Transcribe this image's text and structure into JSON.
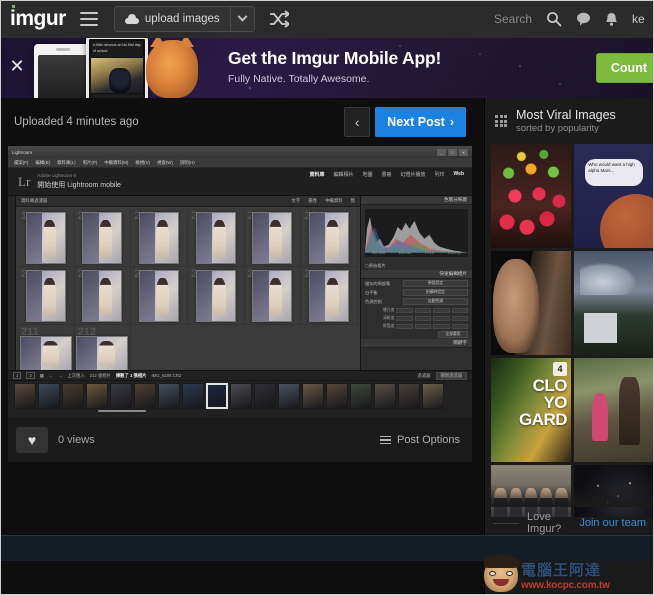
{
  "topnav": {
    "logo": "imgur",
    "menu_icon": "hamburger-icon",
    "upload_label": "upload images",
    "upload_caret_icon": "chevron-down-icon",
    "shuffle_icon": "shuffle-icon",
    "search_label": "Search",
    "search_icon": "search-icon",
    "comments_icon": "comment-icon",
    "notifications_icon": "bell-icon",
    "username": "ke"
  },
  "banner": {
    "close_icon": "close-icon",
    "title": "Get the Imgur Mobile App!",
    "subtitle": "Fully Native. Totally Awesome.",
    "cta_label": "Count",
    "cta_color": "#7dbb3f",
    "phone_caption": "A little nervous on his first day of school"
  },
  "post": {
    "uploaded_text": "Uploaded 4 minutes ago",
    "prev_icon": "chevron-left-icon",
    "next_label": "Next Post",
    "next_icon": "chevron-right-icon",
    "next_color": "#1b82e2",
    "favorite_icon": "heart-icon",
    "views": "0 views",
    "post_options_label": "Post Options",
    "post_options_icon": "hamburger-icon"
  },
  "lightroom": {
    "window_title": "Lightroom",
    "window_controls": [
      "_",
      "□",
      "✕"
    ],
    "menu": [
      "檔案(F)",
      "編輯(E)",
      "資料庫(L)",
      "照片(P)",
      "中繼資料(M)",
      "檢視(V)",
      "視窗(W)",
      "說明(H)"
    ],
    "app_name": "Adobe Lightroom 5",
    "headline": "開始使用 Lightroom mobile",
    "modules": [
      "資料庫",
      "編輯相片",
      "地圖",
      "書冊",
      "幻燈片播放",
      "列印",
      "Web"
    ],
    "filter_label": "資料庫過濾器",
    "filter_options": [
      "文字",
      "屬性",
      "中繼資料",
      "無"
    ],
    "thumb_numbers": [
      "199",
      "200",
      "201",
      "202",
      "203",
      "204",
      "205",
      "206",
      "207",
      "208",
      "209",
      "210",
      "211",
      "212"
    ],
    "right_panels": {
      "histogram_title": "色階分佈圖",
      "histogram_info": [
        "ISO 800",
        "105 mm",
        "f / 4.0",
        "1/125 秒"
      ],
      "original_photo": "原始相片",
      "quick_develop_title": "快速編輯相片",
      "rows": [
        {
          "label": "儲存的預設集",
          "value": "預設設定"
        },
        {
          "label": "白平衡",
          "value": "拍攝時設定"
        },
        {
          "label": "色調控制",
          "value": "自動色調"
        }
      ],
      "sliders": [
        "曝光度",
        "清晰度",
        "鮮豔度"
      ],
      "reset_label": "全部重設",
      "keywords_title": "關鍵字"
    },
    "filmstrip": {
      "import_label": "上次匯入",
      "count_label": "212 張相片",
      "selection_label": "揀數了 1 張相片",
      "filename": "IMG_6208.CR2",
      "filter_label": "過濾器:",
      "filter_value": "關閉過濾器"
    }
  },
  "sidebar": {
    "title": "Most Viral Images",
    "subtitle": "sorted by popularity",
    "grid_icon": "grid-icon",
    "tiles": [
      {
        "name": "colored-cocktail-glasses",
        "badge": ""
      },
      {
        "name": "space-comic-strip",
        "badge": "",
        "caption": "Who would want a high alpha Mars..."
      },
      {
        "name": "man-portrait",
        "badge": ""
      },
      {
        "name": "house-with-clouds",
        "badge": ""
      },
      {
        "name": "garden-vegetables",
        "badge": "4",
        "caption": "CLO\nYO\nGARD"
      },
      {
        "name": "wedding-ceremony",
        "badge": ""
      },
      {
        "name": "group-photo",
        "badge": ""
      },
      {
        "name": "night-sparks",
        "badge": ""
      }
    ],
    "join_prefix": "Love Imgur?",
    "join_link": "Join our team"
  },
  "watermark": {
    "chinese": "電腦王阿達",
    "url": "www.kocpc.com.tw"
  }
}
